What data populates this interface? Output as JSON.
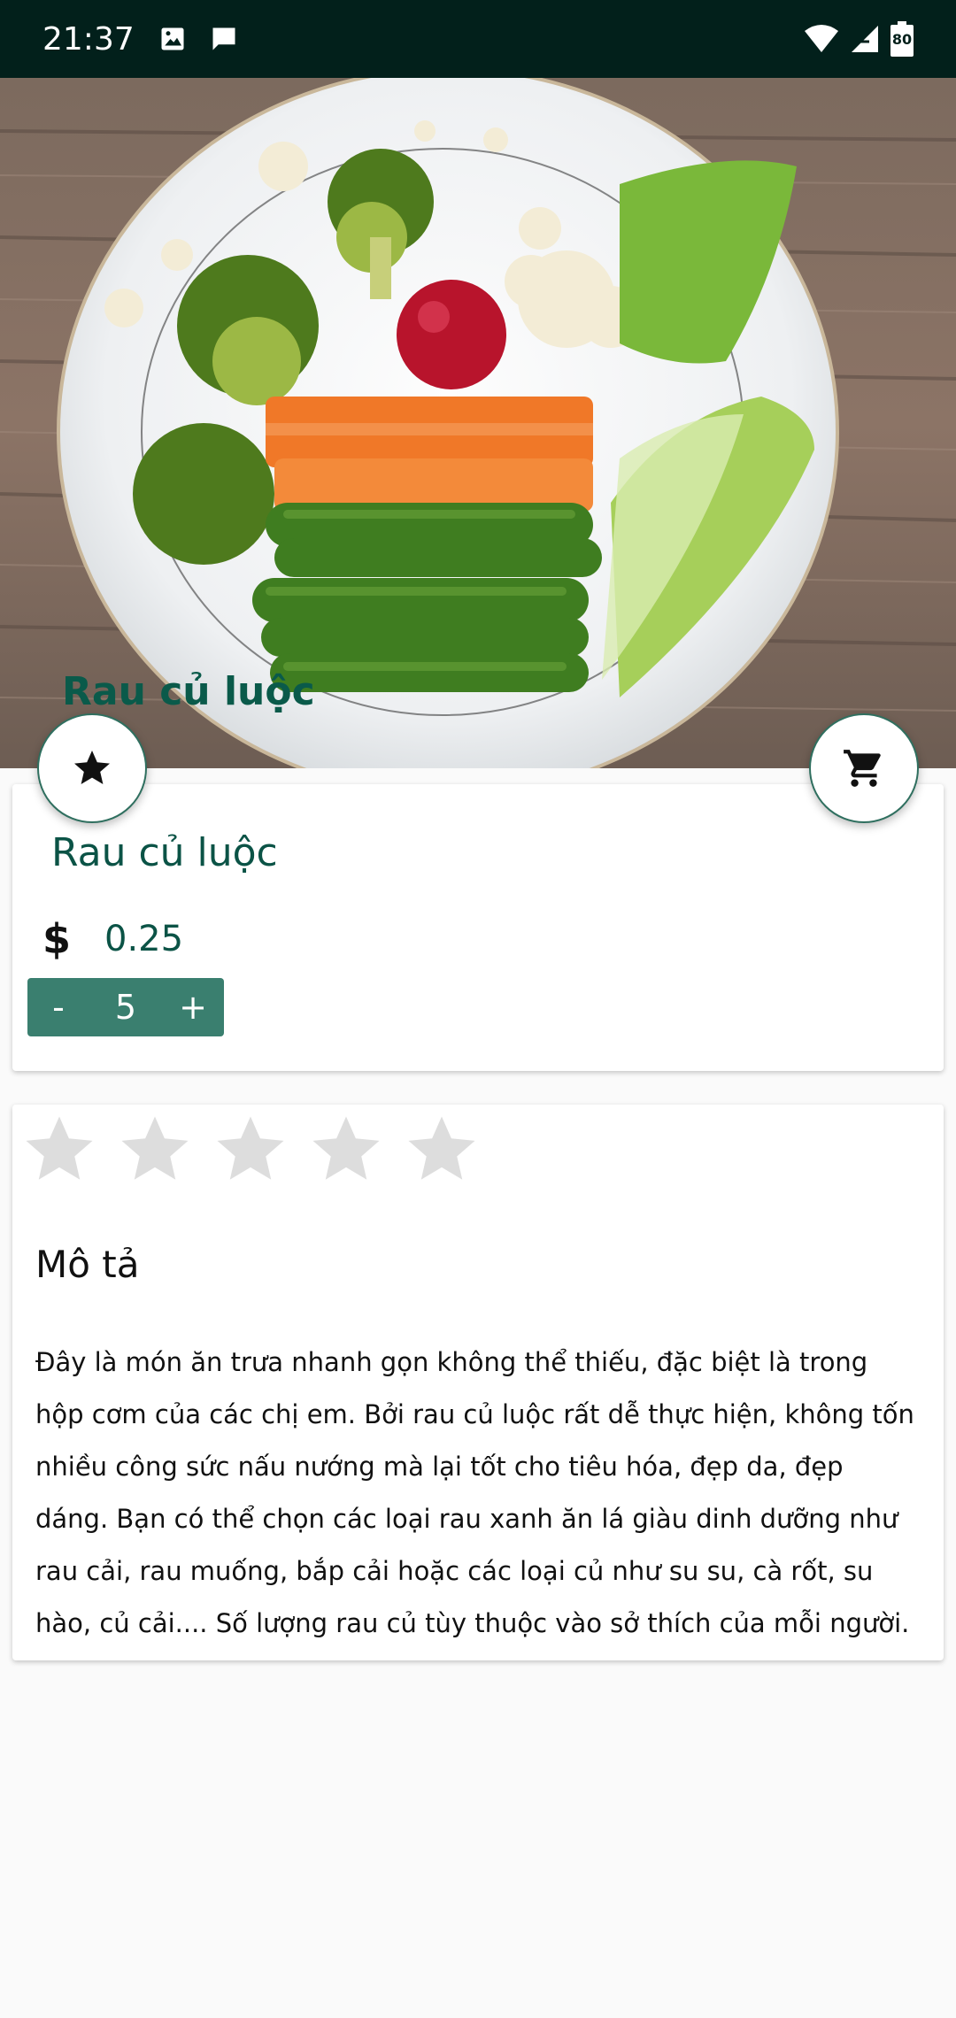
{
  "status_bar": {
    "time": "21:37",
    "battery": "80",
    "icons": [
      "image-icon",
      "message-icon",
      "wifi-icon",
      "signal-icon",
      "battery-icon"
    ]
  },
  "hero": {
    "title": "Rau củ luộc",
    "image": "boiled-vegetables-plate"
  },
  "actions": {
    "favorite_icon": "star-icon",
    "cart_icon": "cart-icon"
  },
  "product": {
    "name": "Rau củ luộc",
    "currency": "$",
    "price": "0.25",
    "quantity": "5",
    "decrement_label": "-",
    "increment_label": "+"
  },
  "rating": {
    "value": 0,
    "max": 5
  },
  "description": {
    "title": "Mô tả",
    "body": "Đây là món ăn trưa nhanh gọn không thể thiếu, đặc biệt là trong hộp cơm của các chị em. Bởi rau củ luộc rất dễ thực hiện, không tốn nhiều công sức nấu nướng mà lại tốt cho tiêu hóa, đẹp da, đẹp dáng. Bạn có thể chọn các loại rau xanh ăn lá giàu dinh dưỡng như rau cải, rau muống, bắp cải hoặc các loại củ như su su, cà rốt, su hào, củ cải.... Số lượng rau củ tùy thuộc vào sở thích của mỗi người."
  },
  "colors": {
    "status_bar": "#02201b",
    "accent": "#3a7f6f",
    "title_text": "#0b5346",
    "star_empty": "#dddddd"
  }
}
